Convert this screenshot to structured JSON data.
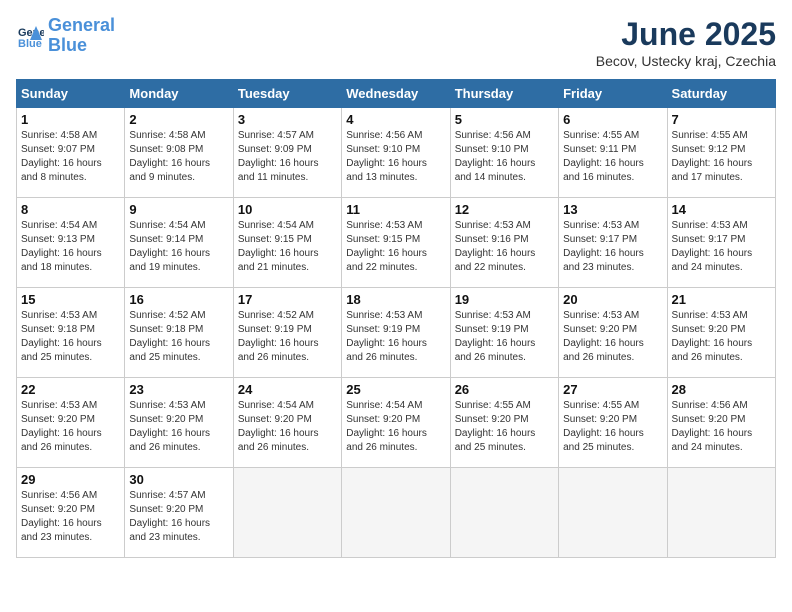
{
  "header": {
    "logo_line1": "General",
    "logo_line2": "Blue",
    "month_title": "June 2025",
    "location": "Becov, Ustecky kraj, Czechia"
  },
  "days_of_week": [
    "Sunday",
    "Monday",
    "Tuesday",
    "Wednesday",
    "Thursday",
    "Friday",
    "Saturday"
  ],
  "weeks": [
    [
      {
        "day": "1",
        "info": "Sunrise: 4:58 AM\nSunset: 9:07 PM\nDaylight: 16 hours\nand 8 minutes."
      },
      {
        "day": "2",
        "info": "Sunrise: 4:58 AM\nSunset: 9:08 PM\nDaylight: 16 hours\nand 9 minutes."
      },
      {
        "day": "3",
        "info": "Sunrise: 4:57 AM\nSunset: 9:09 PM\nDaylight: 16 hours\nand 11 minutes."
      },
      {
        "day": "4",
        "info": "Sunrise: 4:56 AM\nSunset: 9:10 PM\nDaylight: 16 hours\nand 13 minutes."
      },
      {
        "day": "5",
        "info": "Sunrise: 4:56 AM\nSunset: 9:10 PM\nDaylight: 16 hours\nand 14 minutes."
      },
      {
        "day": "6",
        "info": "Sunrise: 4:55 AM\nSunset: 9:11 PM\nDaylight: 16 hours\nand 16 minutes."
      },
      {
        "day": "7",
        "info": "Sunrise: 4:55 AM\nSunset: 9:12 PM\nDaylight: 16 hours\nand 17 minutes."
      }
    ],
    [
      {
        "day": "8",
        "info": "Sunrise: 4:54 AM\nSunset: 9:13 PM\nDaylight: 16 hours\nand 18 minutes."
      },
      {
        "day": "9",
        "info": "Sunrise: 4:54 AM\nSunset: 9:14 PM\nDaylight: 16 hours\nand 19 minutes."
      },
      {
        "day": "10",
        "info": "Sunrise: 4:54 AM\nSunset: 9:15 PM\nDaylight: 16 hours\nand 21 minutes."
      },
      {
        "day": "11",
        "info": "Sunrise: 4:53 AM\nSunset: 9:15 PM\nDaylight: 16 hours\nand 22 minutes."
      },
      {
        "day": "12",
        "info": "Sunrise: 4:53 AM\nSunset: 9:16 PM\nDaylight: 16 hours\nand 22 minutes."
      },
      {
        "day": "13",
        "info": "Sunrise: 4:53 AM\nSunset: 9:17 PM\nDaylight: 16 hours\nand 23 minutes."
      },
      {
        "day": "14",
        "info": "Sunrise: 4:53 AM\nSunset: 9:17 PM\nDaylight: 16 hours\nand 24 minutes."
      }
    ],
    [
      {
        "day": "15",
        "info": "Sunrise: 4:53 AM\nSunset: 9:18 PM\nDaylight: 16 hours\nand 25 minutes."
      },
      {
        "day": "16",
        "info": "Sunrise: 4:52 AM\nSunset: 9:18 PM\nDaylight: 16 hours\nand 25 minutes."
      },
      {
        "day": "17",
        "info": "Sunrise: 4:52 AM\nSunset: 9:19 PM\nDaylight: 16 hours\nand 26 minutes."
      },
      {
        "day": "18",
        "info": "Sunrise: 4:53 AM\nSunset: 9:19 PM\nDaylight: 16 hours\nand 26 minutes."
      },
      {
        "day": "19",
        "info": "Sunrise: 4:53 AM\nSunset: 9:19 PM\nDaylight: 16 hours\nand 26 minutes."
      },
      {
        "day": "20",
        "info": "Sunrise: 4:53 AM\nSunset: 9:20 PM\nDaylight: 16 hours\nand 26 minutes."
      },
      {
        "day": "21",
        "info": "Sunrise: 4:53 AM\nSunset: 9:20 PM\nDaylight: 16 hours\nand 26 minutes."
      }
    ],
    [
      {
        "day": "22",
        "info": "Sunrise: 4:53 AM\nSunset: 9:20 PM\nDaylight: 16 hours\nand 26 minutes."
      },
      {
        "day": "23",
        "info": "Sunrise: 4:53 AM\nSunset: 9:20 PM\nDaylight: 16 hours\nand 26 minutes."
      },
      {
        "day": "24",
        "info": "Sunrise: 4:54 AM\nSunset: 9:20 PM\nDaylight: 16 hours\nand 26 minutes."
      },
      {
        "day": "25",
        "info": "Sunrise: 4:54 AM\nSunset: 9:20 PM\nDaylight: 16 hours\nand 26 minutes."
      },
      {
        "day": "26",
        "info": "Sunrise: 4:55 AM\nSunset: 9:20 PM\nDaylight: 16 hours\nand 25 minutes."
      },
      {
        "day": "27",
        "info": "Sunrise: 4:55 AM\nSunset: 9:20 PM\nDaylight: 16 hours\nand 25 minutes."
      },
      {
        "day": "28",
        "info": "Sunrise: 4:56 AM\nSunset: 9:20 PM\nDaylight: 16 hours\nand 24 minutes."
      }
    ],
    [
      {
        "day": "29",
        "info": "Sunrise: 4:56 AM\nSunset: 9:20 PM\nDaylight: 16 hours\nand 23 minutes."
      },
      {
        "day": "30",
        "info": "Sunrise: 4:57 AM\nSunset: 9:20 PM\nDaylight: 16 hours\nand 23 minutes."
      },
      {
        "day": "",
        "info": ""
      },
      {
        "day": "",
        "info": ""
      },
      {
        "day": "",
        "info": ""
      },
      {
        "day": "",
        "info": ""
      },
      {
        "day": "",
        "info": ""
      }
    ]
  ]
}
